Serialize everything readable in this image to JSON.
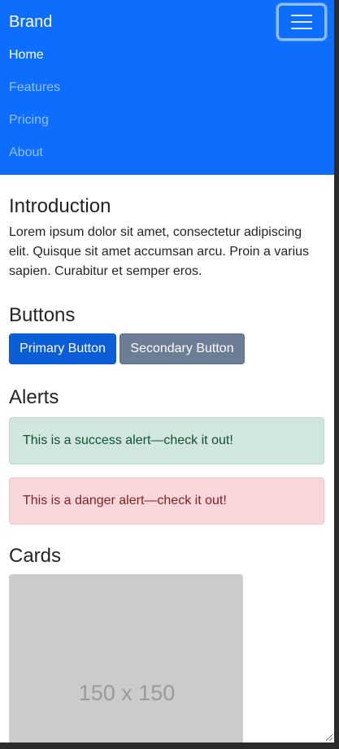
{
  "navbar": {
    "brand": "Brand",
    "toggler_icon": "hamburger-menu-icon",
    "items": [
      {
        "label": "Home",
        "active": true
      },
      {
        "label": "Features",
        "active": false
      },
      {
        "label": "Pricing",
        "active": false
      },
      {
        "label": "About",
        "active": false
      }
    ]
  },
  "intro": {
    "title": "Introduction",
    "text": "Lorem ipsum dolor sit amet, consectetur adipiscing elit. Quisque sit amet accumsan arcu. Proin a varius sapien. Curabitur et semper eros."
  },
  "buttons": {
    "title": "Buttons",
    "primary_label": "Primary Button",
    "secondary_label": "Secondary Button"
  },
  "alerts": {
    "title": "Alerts",
    "success_text": "This is a success alert—check it out!",
    "danger_text": "This is a danger alert—check it out!"
  },
  "cards": {
    "title": "Cards",
    "image_label": "150 x 150"
  },
  "colors": {
    "primary": "#0d6efd",
    "secondary": "#6c757d",
    "success_bg": "#d1e7dd",
    "danger_bg": "#f8d7da"
  }
}
